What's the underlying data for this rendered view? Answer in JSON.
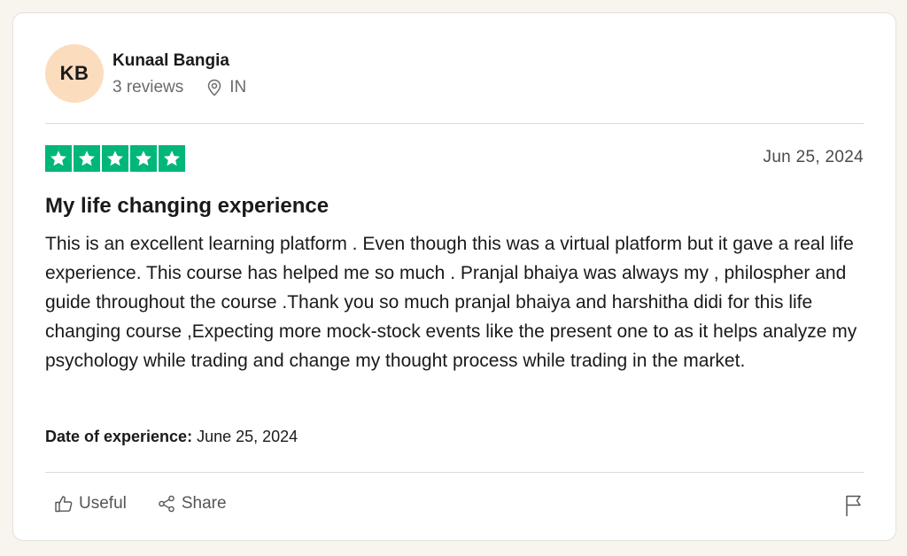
{
  "reviewer": {
    "initials": "KB",
    "name": "Kunaal Bangia",
    "reviews_count": "3 reviews",
    "location": "IN"
  },
  "review": {
    "rating": 5,
    "rating_max": 5,
    "date": "Jun 25, 2024",
    "title": "My life changing experience",
    "body": "This is an excellent learning platform . Even though this was a virtual platform but it gave a real life experience. This course has helped me so much . Pranjal bhaiya was always my , philospher and guide throughout the course .Thank you so much pranjal bhaiya and harshitha didi for this life changing course ,Expecting more mock-stock events like the present one to as it helps analyze my psychology while trading and change my thought process while trading in the market.",
    "experience_label": "Date of experience:",
    "experience_date": "June 25, 2024"
  },
  "actions": {
    "useful_label": "Useful",
    "share_label": "Share"
  },
  "colors": {
    "star_fill": "#00b67a",
    "avatar_bg": "#fbdcbd",
    "page_bg": "#f8f5ee"
  },
  "icons": {
    "location": "location-pin-icon",
    "useful": "thumbs-up-icon",
    "share": "share-icon",
    "flag": "flag-icon",
    "star": "star-icon"
  }
}
